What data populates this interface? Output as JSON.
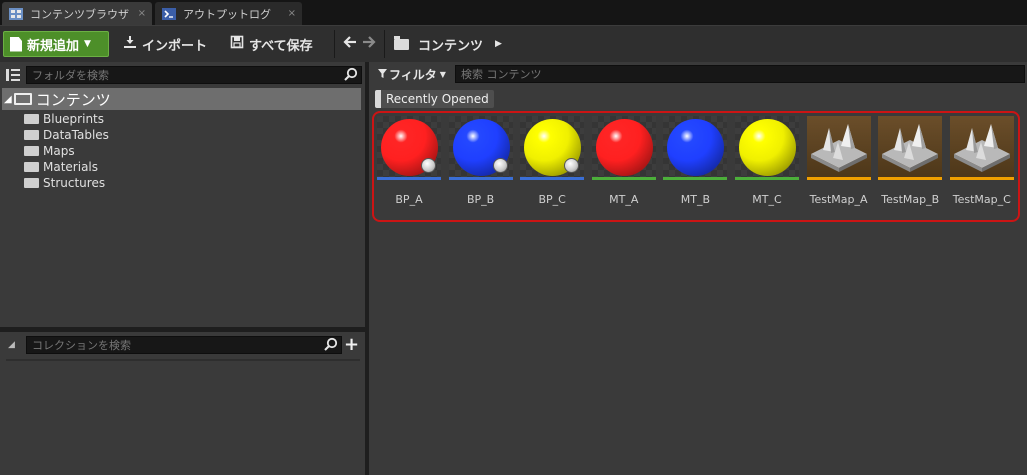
{
  "tabs": [
    {
      "label": "コンテンツブラウザ",
      "close": "×",
      "icon": "content-browser-icon"
    },
    {
      "label": "アウトプットログ",
      "close": "×",
      "icon": "output-log-icon"
    }
  ],
  "toolbar": {
    "new_label": "新規追加",
    "import_label": "インポート",
    "save_all_label": "すべて保存",
    "breadcrumb": "コンテンツ"
  },
  "left": {
    "folder_search_placeholder": "フォルダを検索",
    "root": "コンテンツ",
    "folders": [
      "Blueprints",
      "DataTables",
      "Maps",
      "Materials",
      "Structures"
    ],
    "collection_search_placeholder": "コレクションを検索",
    "collection_add": "+"
  },
  "right": {
    "filter_label": "フィルタ",
    "search_placeholder": "検索 コンテンツ",
    "recent_chip": "Recently Opened"
  },
  "assets": [
    {
      "name": "BP_A",
      "kind": "blueprint",
      "color": "#ff2020",
      "underline": "#3a6ed6"
    },
    {
      "name": "BP_B",
      "kind": "blueprint",
      "color": "#1f3fff",
      "underline": "#3a6ed6"
    },
    {
      "name": "BP_C",
      "kind": "blueprint",
      "color": "#f0f000",
      "underline": "#3a6ed6"
    },
    {
      "name": "MT_A",
      "kind": "material",
      "color": "#ff2020",
      "underline": "#4caf3a"
    },
    {
      "name": "MT_B",
      "kind": "material",
      "color": "#1f3fff",
      "underline": "#4caf3a"
    },
    {
      "name": "MT_C",
      "kind": "material",
      "color": "#f0f000",
      "underline": "#4caf3a"
    },
    {
      "name": "TestMap_A",
      "kind": "map",
      "color": "",
      "underline": "#f0a000"
    },
    {
      "name": "TestMap_B",
      "kind": "map",
      "color": "",
      "underline": "#f0a000"
    },
    {
      "name": "TestMap_C",
      "kind": "map",
      "color": "",
      "underline": "#f0a000"
    }
  ]
}
